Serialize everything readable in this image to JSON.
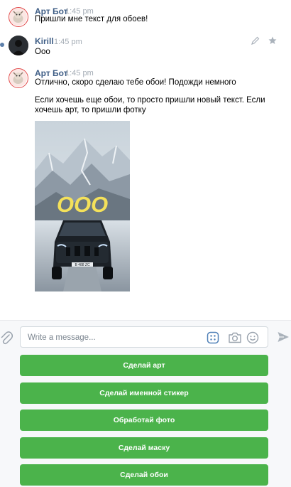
{
  "messages": [
    {
      "author": "Арт Бот",
      "time": "1:45 pm",
      "lines": [
        "Пришли мне текст для обоев!"
      ]
    },
    {
      "author": "Kirill",
      "time": "1:45 pm",
      "lines": [
        "Ооо"
      ]
    },
    {
      "author": "Арт Бот",
      "time": "1:45 pm",
      "lines": [
        "Отлично, скоро сделаю тебе обои! Подожди немного",
        "Если хочешь еще обои, то просто пришли новый текст. Если",
        "хочешь арт, то пришли фотку"
      ],
      "photo_text": "ООО",
      "photo_plate": "B 488 ZC"
    }
  ],
  "composer": {
    "placeholder": "Write a message..."
  },
  "keyboard": {
    "buttons": [
      "Сделай арт",
      "Сделай именной стикер",
      "Обработай фото",
      "Сделай маску",
      "Сделай обои"
    ],
    "button_color": "#4bb34b"
  },
  "icons": {
    "attach": "paperclip-icon",
    "keyboard": "bot-keyboard-icon",
    "camera": "camera-icon",
    "emoji": "smile-icon",
    "send": "send-icon",
    "edit": "pencil-icon",
    "favorite": "star-icon"
  },
  "colors": {
    "author": "#3f5e86",
    "timestamp": "#a4acb5",
    "accent": "#4bb34b"
  }
}
